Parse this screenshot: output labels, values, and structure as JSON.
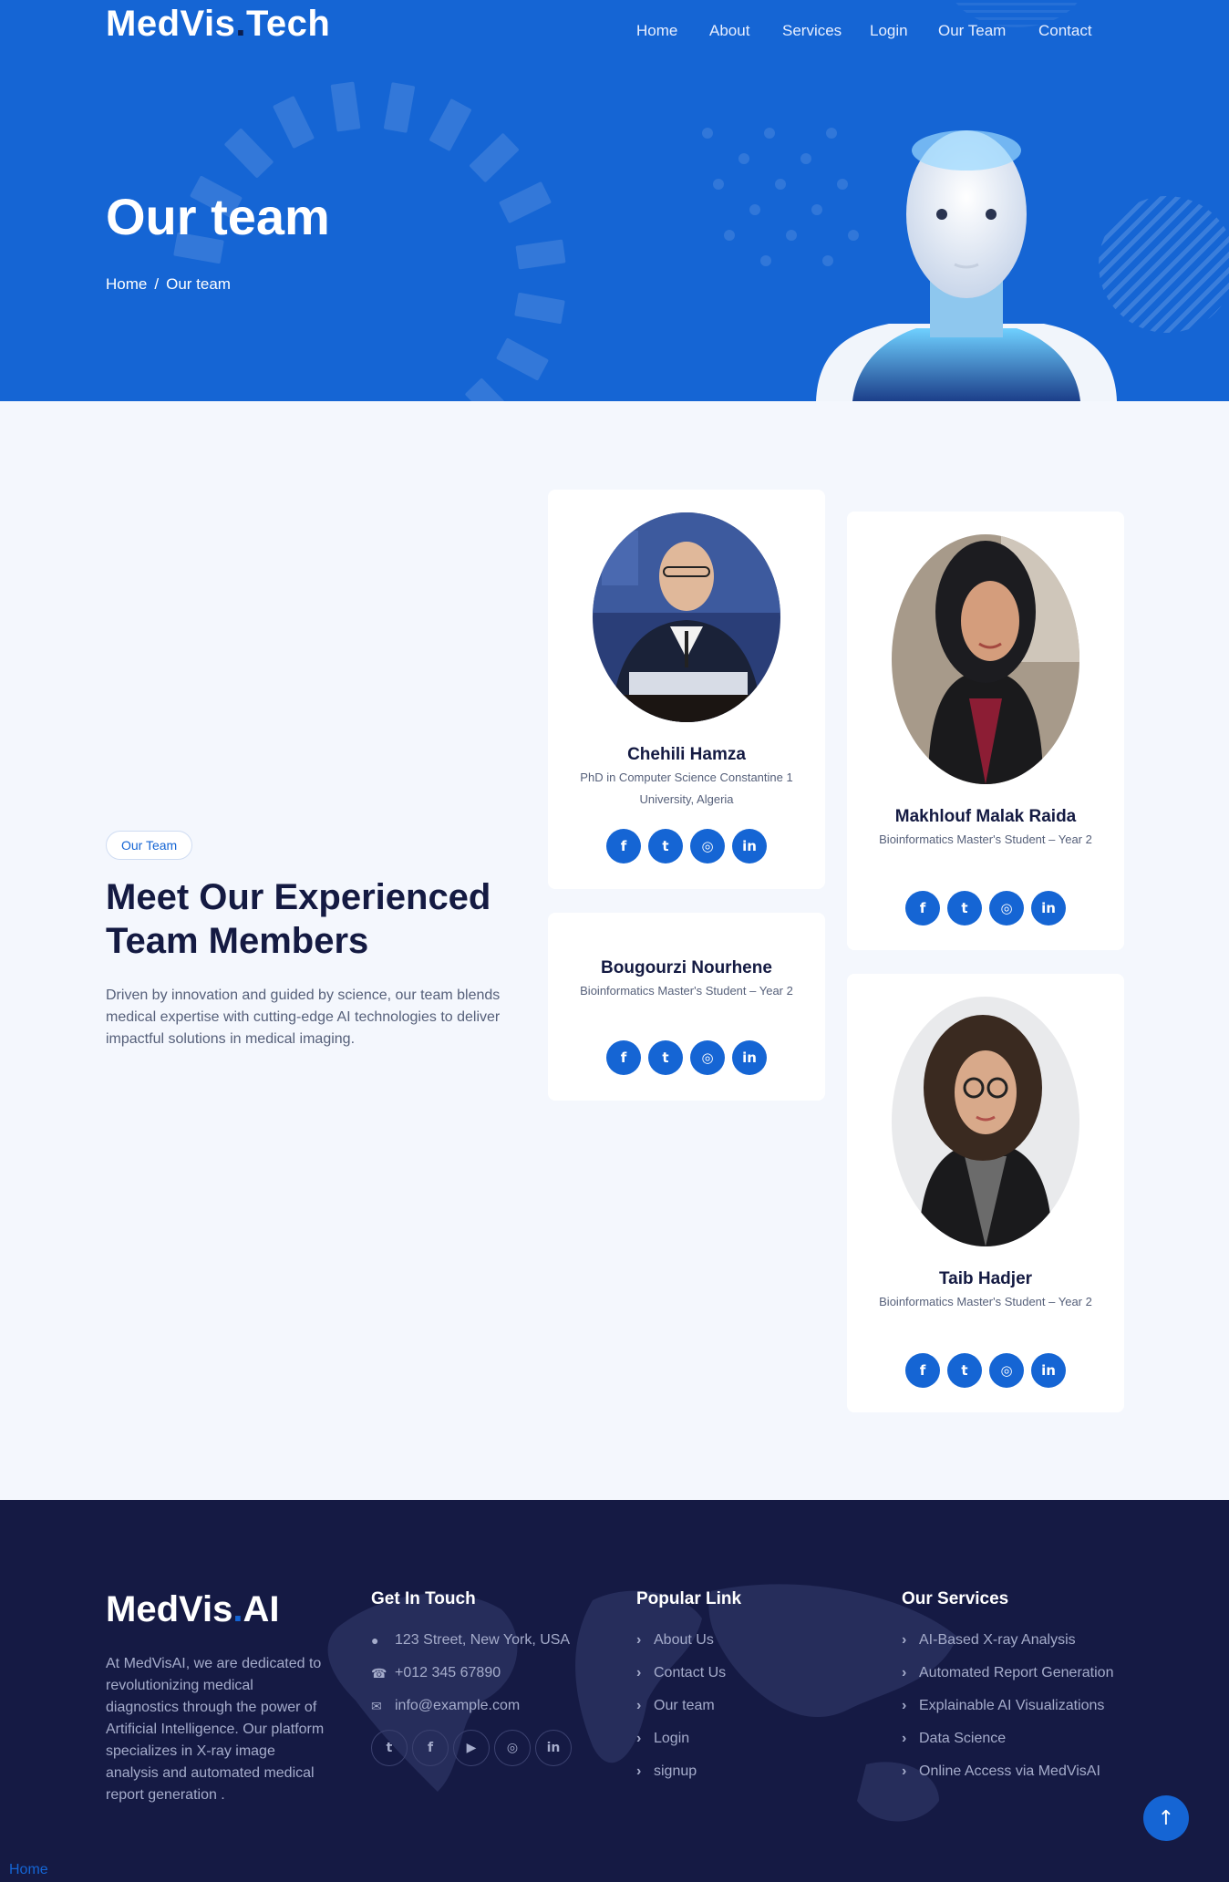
{
  "header": {
    "brand_name": "MedVis",
    "brand_dot": ".",
    "brand_suffix": "Tech",
    "nav": [
      "Home",
      "About",
      "Services",
      "Login",
      "Our Team",
      "Contact"
    ]
  },
  "hero": {
    "title": "Our team",
    "breadcrumb": [
      "Home",
      "Our team"
    ],
    "breadcrumb_sep": "/"
  },
  "team": {
    "tag": "Our Team",
    "title": "Meet Our Experienced Team Members",
    "description": "Driven by innovation and guided by science, our team blends medical expertise with cutting-edge AI technologies to deliver impactful solutions in medical imaging.",
    "members": [
      {
        "name": "Chehili Hamza",
        "role": "PhD in Computer Science Constantine 1 University, Algeria"
      },
      {
        "name": "Makhlouf Malak Raida",
        "role": "Bioinformatics Master's Student – Year 2"
      },
      {
        "name": "Bougourzi Nourhene",
        "role": "Bioinformatics Master's Student – Year 2"
      },
      {
        "name": "Taib Hadjer",
        "role": "Bioinformatics Master's Student – Year 2"
      }
    ],
    "social_icons": [
      "facebook-icon",
      "twitter-icon",
      "instagram-icon",
      "linkedin-icon"
    ]
  },
  "footer": {
    "brand_name": "MedVis",
    "brand_dot": ".",
    "brand_suffix": "AI",
    "about": "At MedVisAI, we are dedicated to revolutionizing medical diagnostics through the power of Artificial Intelligence. Our platform specializes in X-ray image analysis and automated medical report generation .",
    "contact": {
      "heading": "Get In Touch",
      "address": "123 Street, New York, USA",
      "phone": "+012 345 67890",
      "email": "info@example.com"
    },
    "popular": {
      "heading": "Popular Link",
      "links": [
        "About Us",
        "Contact Us",
        "Our team",
        "Login",
        "signup"
      ]
    },
    "services": {
      "heading": "Our Services",
      "links": [
        "AI-Based X-ray Analysis",
        "Automated Report Generation",
        "Explainable AI Visualizations",
        "Data Science",
        "Online Access via MedVisAI"
      ]
    },
    "social_icons": [
      "twitter-icon",
      "facebook-icon",
      "youtube-icon",
      "instagram-icon",
      "linkedin-icon"
    ]
  },
  "bottom_link": "Home",
  "colors": {
    "primary": "#1565d4",
    "dark": "#151a44",
    "heading": "#141a42",
    "page_bg": "#f4f7fd"
  }
}
